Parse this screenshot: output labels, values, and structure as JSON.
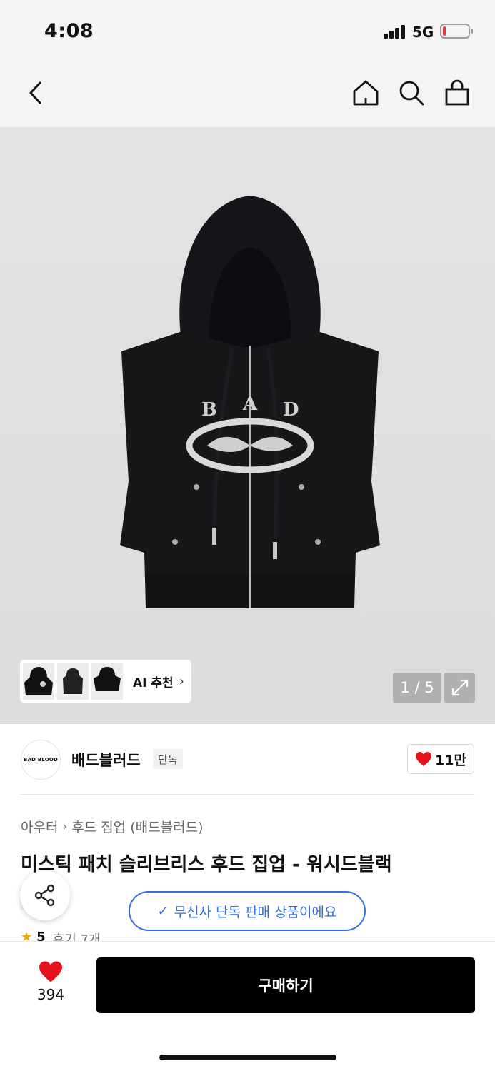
{
  "status_bar": {
    "time": "4:08",
    "network": "5G"
  },
  "header": {
    "back_icon": "chevron-left-icon",
    "home_icon": "home-icon",
    "search_icon": "search-icon",
    "cart_icon": "shopping-bag-icon"
  },
  "gallery": {
    "ai_recommend_label": "AI 추천",
    "counter": "1 / 5",
    "expand_icon": "expand-icon"
  },
  "brand": {
    "logo_text": "BAD BLOOD",
    "name": "배드블러드",
    "exclusive_tag": "단독",
    "like_count": "11만"
  },
  "product": {
    "breadcrumb": [
      "아우터",
      "후드 집업 (배드블러드)"
    ],
    "title": "미스틱 패치 슬리브리스 후드 집업 - 워시드블랙",
    "tag": "단독",
    "rating": "5",
    "review_text": "후기 7개"
  },
  "toast": {
    "text": "무신사 단독 판매 상품이에요"
  },
  "bottom_bar": {
    "wish_count": "394",
    "buy_label": "구매하기"
  },
  "colors": {
    "accent_blue": "#2f6fe0",
    "heart_red": "#e5121c",
    "buy_button": "#000000",
    "star": "#f3a400"
  }
}
